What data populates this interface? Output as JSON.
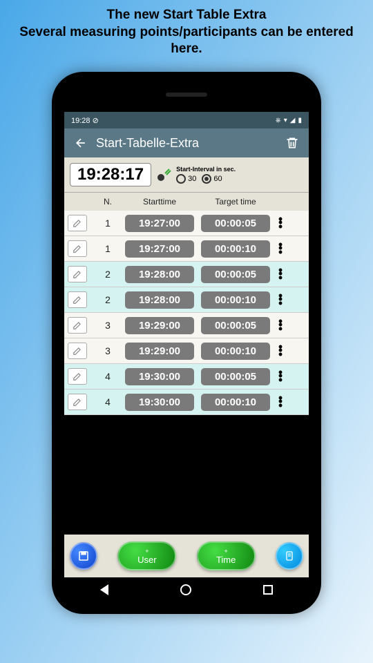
{
  "caption": "The new Start Table Extra\nSeveral measuring points/participants can be entered here.",
  "status": {
    "time": "19:28"
  },
  "appbar": {
    "title": "Start-Tabelle-Extra"
  },
  "clock": {
    "time": "19:28:17"
  },
  "interval": {
    "label": "Start-Interval in sec.",
    "options": [
      {
        "value": "30",
        "selected": false
      },
      {
        "value": "60",
        "selected": true
      }
    ]
  },
  "headers": {
    "n": "N.",
    "start": "Starttime",
    "target": "Target time"
  },
  "rows": [
    {
      "n": "1",
      "start": "19:27:00",
      "target": "00:00:05",
      "style": "odd"
    },
    {
      "n": "1",
      "start": "19:27:00",
      "target": "00:00:10",
      "style": "odd"
    },
    {
      "n": "2",
      "start": "19:28:00",
      "target": "00:00:05",
      "style": "even"
    },
    {
      "n": "2",
      "start": "19:28:00",
      "target": "00:00:10",
      "style": "even"
    },
    {
      "n": "3",
      "start": "19:29:00",
      "target": "00:00:05",
      "style": "odd"
    },
    {
      "n": "3",
      "start": "19:29:00",
      "target": "00:00:10",
      "style": "odd"
    },
    {
      "n": "4",
      "start": "19:30:00",
      "target": "00:00:05",
      "style": "even"
    },
    {
      "n": "4",
      "start": "19:30:00",
      "target": "00:00:10",
      "style": "even"
    }
  ],
  "buttons": {
    "user": "User",
    "time": "Time"
  }
}
